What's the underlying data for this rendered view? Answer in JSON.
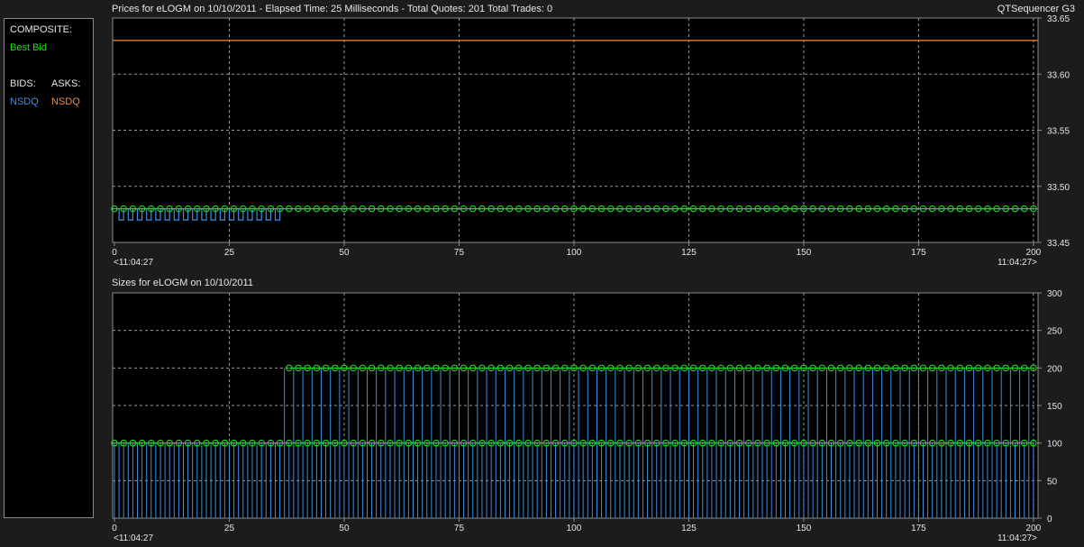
{
  "header": {
    "prices_title": "Prices for  eLOGM  on  10/10/2011  -  Elapsed Time: 25 Milliseconds  -  Total Quotes: 201  Total Trades: 0",
    "app_name": "QTSequencer G3",
    "sizes_title": "Sizes for  eLOGM  on  10/10/2011"
  },
  "legend": {
    "composite_label": "COMPOSITE:",
    "best_bid_label": "Best Bid",
    "bids_label": "BIDS:",
    "asks_label": "ASKS:",
    "bid_exchange": "NSDQ",
    "ask_exchange": "NSDQ"
  },
  "colors": {
    "best_bid": "#22dd22",
    "bid": "#3a8fe0",
    "ask": "#f08a3c",
    "grid": "#9a9a9a",
    "background": "#000000"
  },
  "x_axis": {
    "start_time": "<11:04:27",
    "end_time": "11:04:27>"
  },
  "chart_data": [
    {
      "type": "line",
      "name": "prices",
      "x_range": [
        0,
        201
      ],
      "x_ticks": [
        0,
        25,
        50,
        75,
        100,
        125,
        150,
        175,
        200
      ],
      "ylim": [
        33.45,
        33.65
      ],
      "y_ticks": [
        "33.45",
        "33.50",
        "33.55",
        "33.60",
        "33.65"
      ],
      "grid": true,
      "series": [
        {
          "name": "NSDQ",
          "side": "bid",
          "pattern": "x 0-36 alternates 33.48 (even) / 33.47 (odd); x 37-200 constant 33.48",
          "values_summary": {
            "from_x": 37,
            "to_x": 200,
            "value": 33.48
          }
        },
        {
          "name": "NSDQ",
          "side": "ask",
          "values_summary": {
            "from_x": 0,
            "to_x": 200,
            "value": 33.63
          }
        },
        {
          "name": "Best Bid",
          "markers_every_x": 2,
          "value": 33.48,
          "from_x": 0,
          "to_x": 200
        }
      ]
    },
    {
      "type": "bar",
      "name": "sizes",
      "x_range": [
        0,
        201
      ],
      "x_ticks": [
        0,
        25,
        50,
        75,
        100,
        125,
        150,
        175,
        200
      ],
      "ylim": [
        0,
        300
      ],
      "y_ticks": [
        "0",
        "50",
        "100",
        "150",
        "200",
        "250",
        "300"
      ],
      "grid": true,
      "series": [
        {
          "name": "NSDQ",
          "side": "bid",
          "pattern": "x 0-36 all 100; x 37-200 alternates 200 (odd) / 100 (even)"
        },
        {
          "name": "Best Bid",
          "markers_every_x": 2,
          "pattern": "markers at 100 for all x; markers at 200 for x >= 37"
        }
      ]
    }
  ]
}
